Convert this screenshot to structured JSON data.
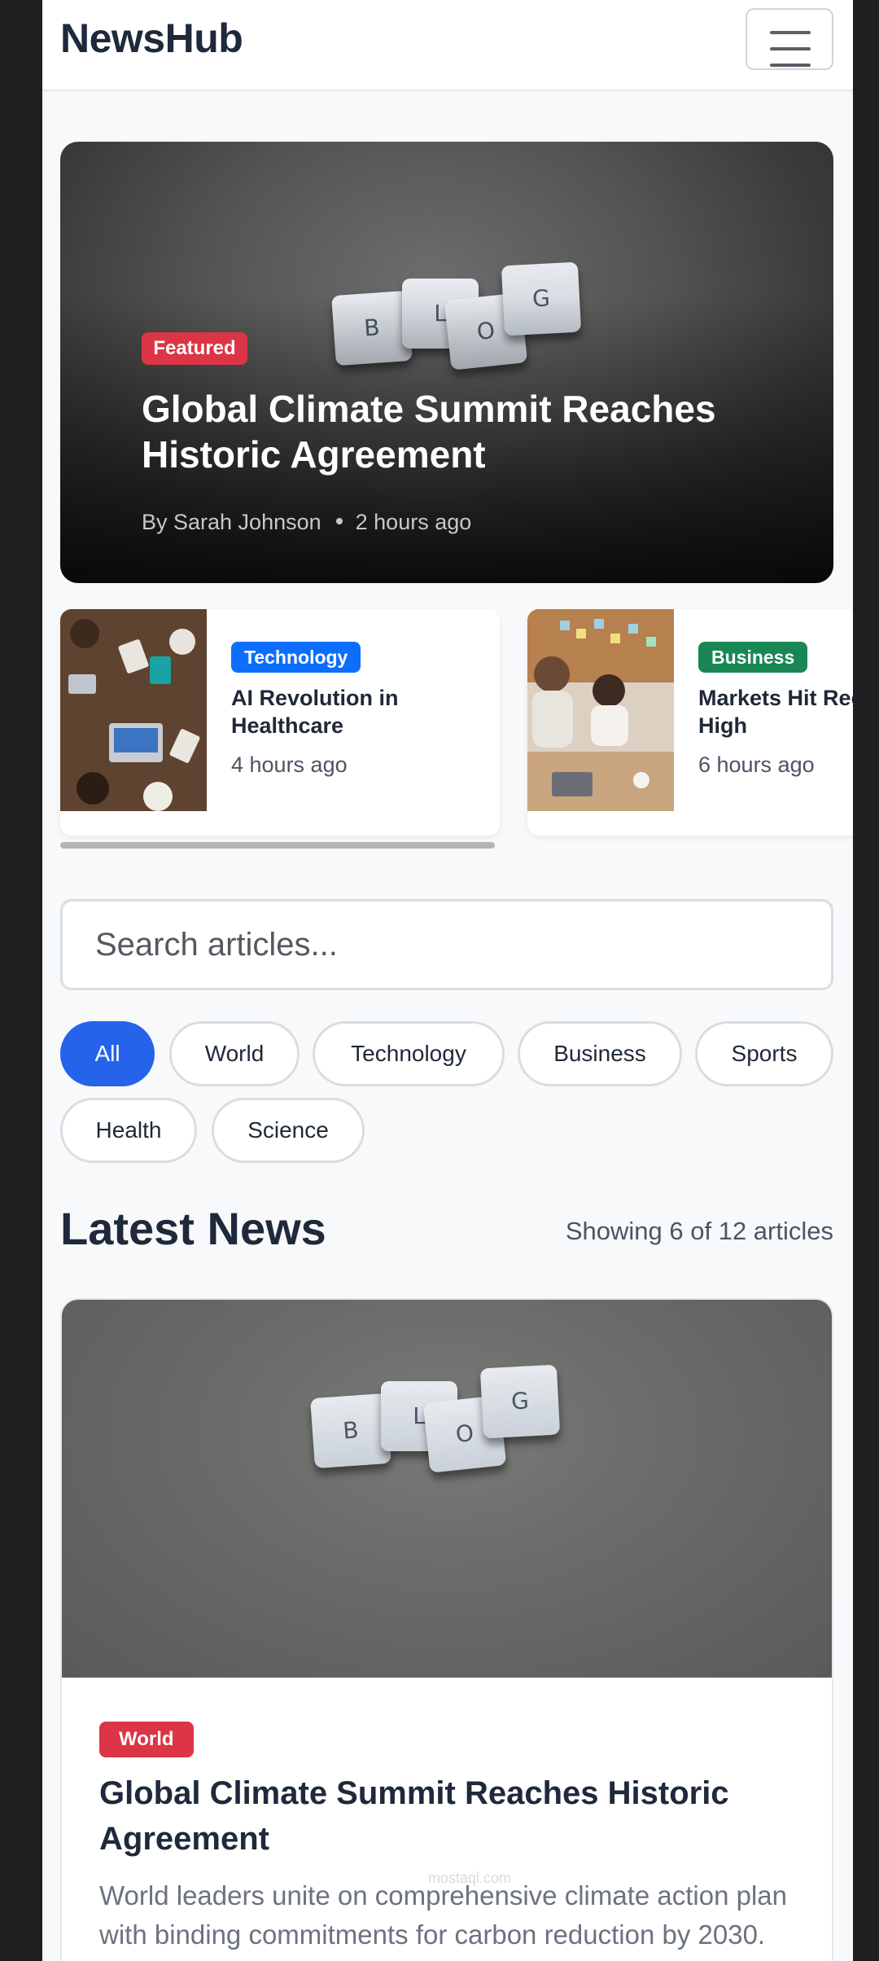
{
  "navbar": {
    "brand": "NewsHub",
    "menu_icon": "hamburger-menu-icon"
  },
  "hero": {
    "badge": "Featured",
    "title": "Global Climate Summit Reaches Historic Agreement",
    "author": "By Sarah Johnson",
    "time": "2 hours ago",
    "image_tiles": [
      "B",
      "L",
      "O",
      "G"
    ]
  },
  "carousel": [
    {
      "badge": "Technology",
      "badge_color": "#0d6efd",
      "title": "AI Revolution in Healthcare",
      "time": "4 hours ago"
    },
    {
      "badge": "Business",
      "badge_color": "#198754",
      "title": "Markets Hit Record High",
      "time": "6 hours ago"
    }
  ],
  "search": {
    "placeholder": "Search articles..."
  },
  "filters": [
    "All",
    "World",
    "Technology",
    "Business",
    "Sports",
    "Health",
    "Science"
  ],
  "filters_active": "All",
  "latest": {
    "title": "Latest News",
    "count": "Showing 6 of 12 articles"
  },
  "article": {
    "badge": "World",
    "title": "Global Climate Summit Reaches Historic Agreement",
    "excerpt": "World leaders unite on comprehensive climate action plan with binding commitments for carbon reduction by 2030.",
    "image_tiles": [
      "B",
      "L",
      "O",
      "G"
    ]
  },
  "watermark": "mostaql.com",
  "colors": {
    "accent": "#2563eb",
    "featured": "#dc3545",
    "technology": "#0d6efd",
    "business": "#198754"
  }
}
